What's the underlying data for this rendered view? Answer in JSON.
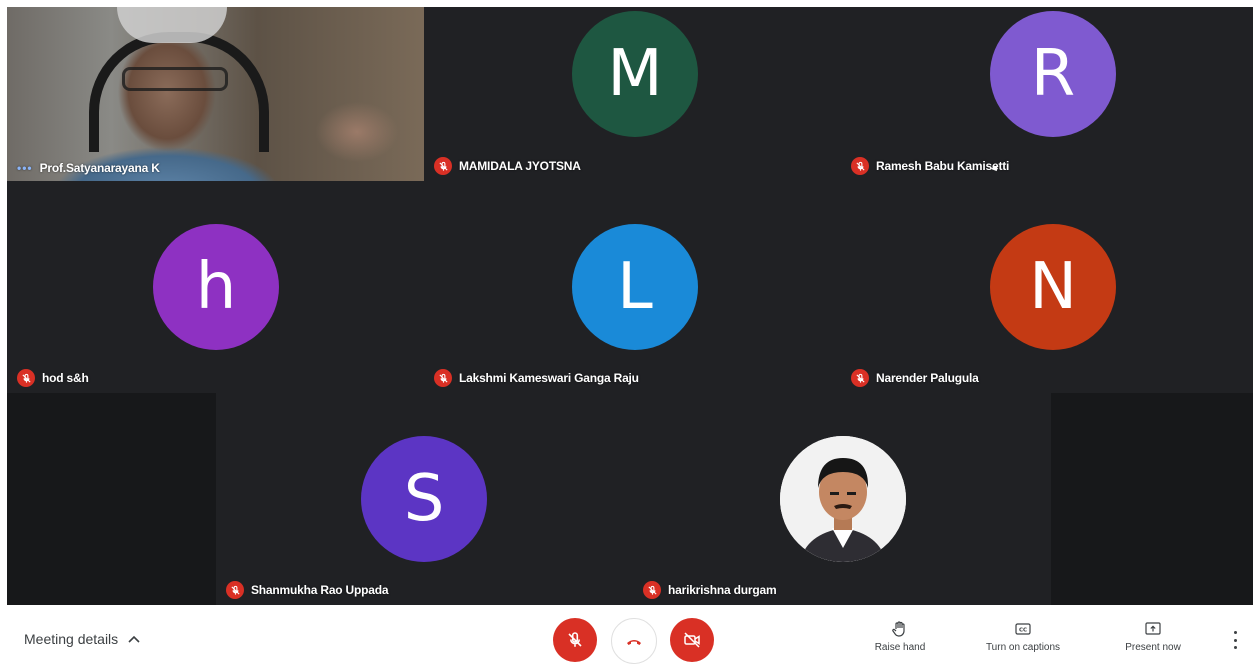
{
  "participants": [
    {
      "id": "p1",
      "name": "Prof.Satyanarayana K",
      "type": "video"
    },
    {
      "id": "p2",
      "name": "MAMIDALA JYOTSNA",
      "initial": "M",
      "color": "#1e5741"
    },
    {
      "id": "p3",
      "name": "Ramesh Babu Kamisetti",
      "initial": "R",
      "color": "#7f5ad0"
    },
    {
      "id": "p4",
      "name": "hod s&h",
      "initial": "h",
      "color": "#8e31c2"
    },
    {
      "id": "p5",
      "name": "Lakshmi Kameswari Ganga Raju",
      "initial": "L",
      "color": "#1a8ad8"
    },
    {
      "id": "p6",
      "name": "Narender Palugula",
      "initial": "N",
      "color": "#c43a14"
    },
    {
      "id": "p7",
      "name": "Shanmukha Rao Uppada",
      "initial": "S",
      "color": "#5c35c4"
    },
    {
      "id": "p8",
      "name": "harikrishna durgam",
      "type": "photo"
    }
  ],
  "bottom_bar": {
    "meeting_details": "Meeting details",
    "raise_hand": "Raise hand",
    "captions": "Turn on captions",
    "present": "Present now"
  },
  "colors": {
    "stage": "#202124",
    "mute": "#d93025",
    "leave_icon": "#d93025"
  },
  "icons": {
    "mic": "mic-off-icon",
    "camera": "camera-off-icon",
    "leave": "phone-hangup-icon",
    "hand": "hand-icon",
    "captions": "cc-icon",
    "present": "present-icon",
    "more": "more-vertical-icon",
    "details": "chevron-up-icon",
    "speaking": "speaking-dots-icon"
  }
}
